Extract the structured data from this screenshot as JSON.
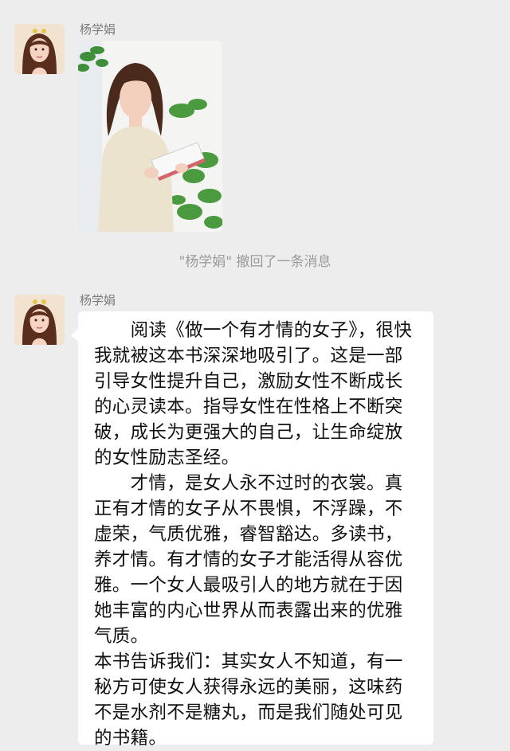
{
  "messages": [
    {
      "sender": "杨学娟",
      "type": "image"
    },
    {
      "sender": "杨学娟",
      "type": "text",
      "paragraphs": [
        "　　阅读《做一个有才情的女子》，很快我就被这本书深深地吸引了。这是一部引导女性提升自己，激励女性不断成长的心灵读本。指导女性在性格上不断突破，成长为更强大的自己，让生命绽放的女性励志圣经。",
        "　　才情，是女人永不过时的衣裳。真正有才情的女子从不畏惧，不浮躁，不虚荣，气质优雅，睿智豁达。多读书，养才情。有才情的女子才能活得从容优雅。一个女人最吸引人的地方就在于因她丰富的内心世界从而表露出来的优雅气质。",
        "本书告诉我们：其实女人不知道，有一秘方可使女人获得永远的美丽，这味药不是水剂不是糖丸，而是我们随处可见的书籍。"
      ]
    }
  ],
  "system_notice": "\"杨学娟\" 撤回了一条消息",
  "colors": {
    "background": "#ededed",
    "bubble": "#ffffff",
    "notice": "#9a9a9a"
  }
}
